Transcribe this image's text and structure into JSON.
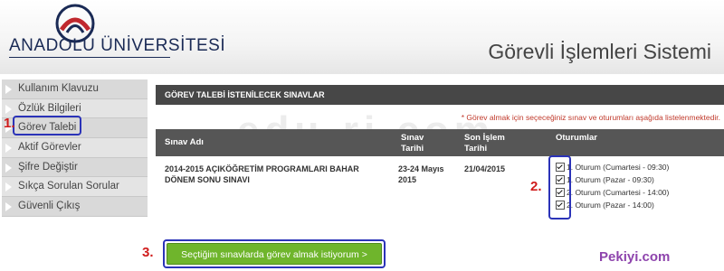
{
  "header": {
    "university": "ANADOLU ÜNİVERSİTESİ",
    "system_title": "Görevli İşlemleri Sistemi"
  },
  "sidebar": {
    "items": [
      {
        "label": "Kullanım Klavuzu"
      },
      {
        "label": "Özlük Bilgileri"
      },
      {
        "label": "Görev Talebi"
      },
      {
        "label": "Aktif Görevler"
      },
      {
        "label": "Şifre Değiştir"
      },
      {
        "label": "Sıkça Sorulan Sorular"
      },
      {
        "label": "Güvenli Çıkış"
      }
    ]
  },
  "panel": {
    "title": "GÖREV TALEBİ İSTENİLECEK SINAVLAR",
    "note": "* Görev almak için seçeceğiniz sınav ve oturumları aşağıda listelenmektedir."
  },
  "table": {
    "headers": {
      "exam_name": "Sınav Adı",
      "exam_date_1": "Sınav",
      "exam_date_2": "Tarihi",
      "deadline_1": "Son İşlem",
      "deadline_2": "Tarihi",
      "sessions": "Oturumlar"
    },
    "rows": [
      {
        "exam_name_1": "2014-2015 AÇIKÖĞRETİM PROGRAMLARI BAHAR",
        "exam_name_2": "DÖNEM SONU SINAVI",
        "date_1": "23-24 Mayıs",
        "date_2": "2015",
        "deadline": "21/04/2015",
        "sessions": [
          {
            "label": "1. Oturum (Cumartesi - 09:30)",
            "checked": true
          },
          {
            "label": "1. Oturum (Pazar - 09:30)",
            "checked": true
          },
          {
            "label": "2. Oturum (Cumartesi - 14:00)",
            "checked": true
          },
          {
            "label": "2. Oturum (Pazar - 14:00)",
            "checked": true
          }
        ]
      }
    ]
  },
  "submit_label": "Seçtiğim sınavlarda görev almak istiyorum >",
  "annotations": {
    "step1": "1.",
    "step2": "2.",
    "step3": "3."
  },
  "watermark": "edu-ri.com",
  "credit": "Pekiyi.com",
  "colors": {
    "accent_green": "#6fb52c",
    "annotation_red": "#d01c1c",
    "highlight_blue": "#2b33b8",
    "panel_dark": "#474747"
  }
}
